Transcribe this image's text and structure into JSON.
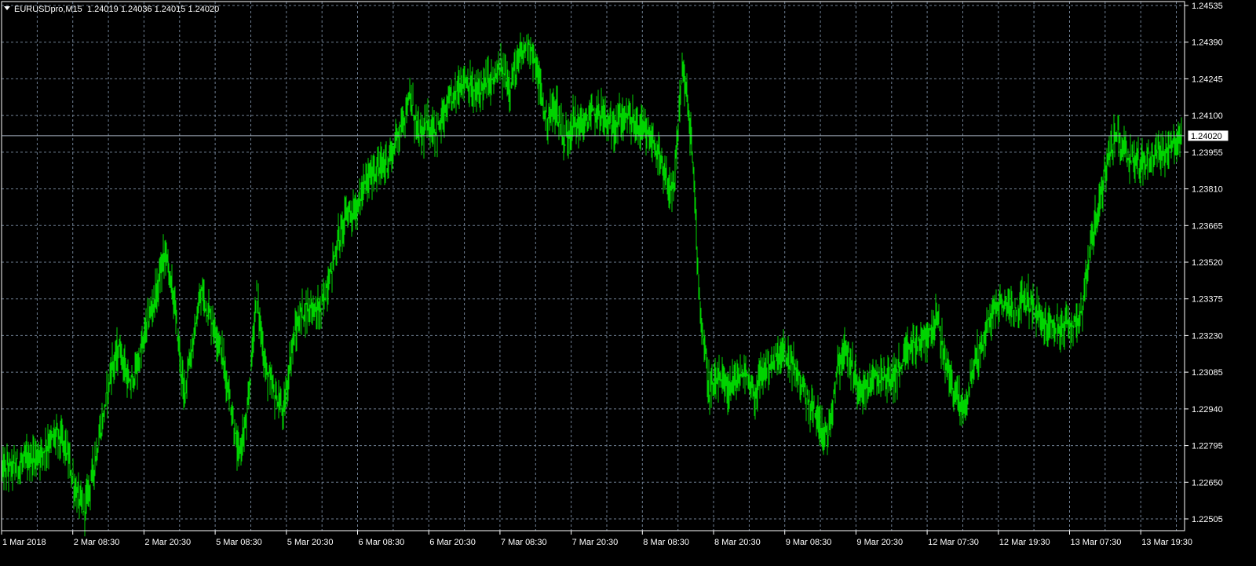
{
  "header": {
    "symbol_label": "EURUSDpro,M15",
    "ohlc_label": "1.24019 1.24036 1.24015 1.24020"
  },
  "colors": {
    "background": "#000000",
    "grid": "#6f7f93",
    "axis": "#ffffff",
    "series": "#00d400",
    "price_line": "#a9b4c2",
    "text": "#ffffff"
  },
  "chart_data": {
    "type": "bar",
    "symbol": "EURUSDpro",
    "timeframe": "M15",
    "ylim": [
      1.2245,
      1.2455
    ],
    "y_ticks": [
      "1.24535",
      "1.24390",
      "1.24245",
      "1.24100",
      "1.23955",
      "1.23810",
      "1.23665",
      "1.23520",
      "1.23375",
      "1.23230",
      "1.23085",
      "1.22940",
      "1.22795",
      "1.22650",
      "1.22505"
    ],
    "x_ticks": [
      "1 Mar 2018",
      "2 Mar 08:30",
      "2 Mar 20:30",
      "5 Mar 08:30",
      "5 Mar 20:30",
      "6 Mar 08:30",
      "6 Mar 20:30",
      "7 Mar 08:30",
      "7 Mar 20:30",
      "8 Mar 08:30",
      "8 Mar 20:30",
      "9 Mar 08:30",
      "9 Mar 20:30",
      "12 Mar 07:30",
      "12 Mar 19:30",
      "13 Mar 07:30",
      "13 Mar 19:30"
    ],
    "current_price": "1.24020",
    "grid": true,
    "close_path": [
      [
        0,
        1.227
      ],
      [
        2,
        1.2272
      ],
      [
        4,
        1.2276
      ],
      [
        6,
        1.2284
      ],
      [
        7,
        1.2279
      ],
      [
        8,
        1.2262
      ],
      [
        9,
        1.2254
      ],
      [
        10,
        1.227
      ],
      [
        11,
        1.2288
      ],
      [
        12,
        1.231
      ],
      [
        13,
        1.2318
      ],
      [
        14,
        1.2302
      ],
      [
        15,
        1.2312
      ],
      [
        16,
        1.2328
      ],
      [
        17,
        1.234
      ],
      [
        18,
        1.2357
      ],
      [
        19,
        1.2335
      ],
      [
        20,
        1.23
      ],
      [
        21,
        1.232
      ],
      [
        22,
        1.234
      ],
      [
        23,
        1.233
      ],
      [
        24,
        1.232
      ],
      [
        25,
        1.23
      ],
      [
        26,
        1.2275
      ],
      [
        27,
        1.229
      ],
      [
        28,
        1.234
      ],
      [
        29,
        1.231
      ],
      [
        30,
        1.23
      ],
      [
        31,
        1.2292
      ],
      [
        32,
        1.232
      ],
      [
        33,
        1.2332
      ],
      [
        34,
        1.2335
      ],
      [
        35,
        1.2332
      ],
      [
        36,
        1.2345
      ],
      [
        37,
        1.236
      ],
      [
        38,
        1.2372
      ],
      [
        39,
        1.2372
      ],
      [
        40,
        1.2383
      ],
      [
        41,
        1.2388
      ],
      [
        42,
        1.239
      ],
      [
        43,
        1.2395
      ],
      [
        44,
        1.2408
      ],
      [
        45,
        1.2416
      ],
      [
        46,
        1.2402
      ],
      [
        47,
        1.2406
      ],
      [
        48,
        1.2404
      ],
      [
        49,
        1.2412
      ],
      [
        50,
        1.242
      ],
      [
        51,
        1.2425
      ],
      [
        52,
        1.2418
      ],
      [
        53,
        1.2422
      ],
      [
        54,
        1.2424
      ],
      [
        55,
        1.2428
      ],
      [
        56,
        1.2422
      ],
      [
        57,
        1.2432
      ],
      [
        58,
        1.244
      ],
      [
        59,
        1.2426
      ],
      [
        60,
        1.2408
      ],
      [
        61,
        1.2414
      ],
      [
        62,
        1.24
      ],
      [
        63,
        1.2408
      ],
      [
        64,
        1.2406
      ],
      [
        65,
        1.241
      ],
      [
        66,
        1.2412
      ],
      [
        67,
        1.2405
      ],
      [
        68,
        1.2408
      ],
      [
        69,
        1.241
      ],
      [
        70,
        1.2406
      ],
      [
        71,
        1.2402
      ],
      [
        72,
        1.2398
      ],
      [
        73,
        1.2385
      ],
      [
        74,
        1.2378
      ],
      [
        75,
        1.243
      ],
      [
        76,
        1.24
      ],
      [
        77,
        1.233
      ],
      [
        78,
        1.23
      ],
      [
        79,
        1.2305
      ],
      [
        80,
        1.2302
      ],
      [
        81,
        1.2306
      ],
      [
        82,
        1.2308
      ],
      [
        83,
        1.23
      ],
      [
        84,
        1.231
      ],
      [
        85,
        1.2312
      ],
      [
        86,
        1.2316
      ],
      [
        87,
        1.2312
      ],
      [
        88,
        1.2305
      ],
      [
        89,
        1.2296
      ],
      [
        90,
        1.229
      ],
      [
        91,
        1.2282
      ],
      [
        92,
        1.231
      ],
      [
        93,
        1.2318
      ],
      [
        94,
        1.2306
      ],
      [
        95,
        1.2302
      ],
      [
        96,
        1.2305
      ],
      [
        97,
        1.2308
      ],
      [
        98,
        1.2306
      ],
      [
        99,
        1.231
      ],
      [
        100,
        1.2318
      ],
      [
        101,
        1.232
      ],
      [
        102,
        1.2322
      ],
      [
        103,
        1.233
      ],
      [
        104,
        1.2312
      ],
      [
        105,
        1.23
      ],
      [
        106,
        1.2294
      ],
      [
        107,
        1.231
      ],
      [
        108,
        1.232
      ],
      [
        109,
        1.233
      ],
      [
        110,
        1.2336
      ],
      [
        111,
        1.2335
      ],
      [
        112,
        1.2334
      ],
      [
        113,
        1.2338
      ],
      [
        114,
        1.2332
      ],
      [
        115,
        1.2326
      ],
      [
        116,
        1.2328
      ],
      [
        117,
        1.2325
      ],
      [
        118,
        1.2328
      ],
      [
        119,
        1.2332
      ],
      [
        120,
        1.236
      ],
      [
        121,
        1.2375
      ],
      [
        122,
        1.2395
      ],
      [
        123,
        1.2402
      ],
      [
        124,
        1.2394
      ],
      [
        125,
        1.2392
      ],
      [
        126,
        1.2392
      ],
      [
        127,
        1.2394
      ],
      [
        128,
        1.2396
      ],
      [
        129,
        1.2398
      ],
      [
        130,
        1.2402
      ]
    ]
  }
}
